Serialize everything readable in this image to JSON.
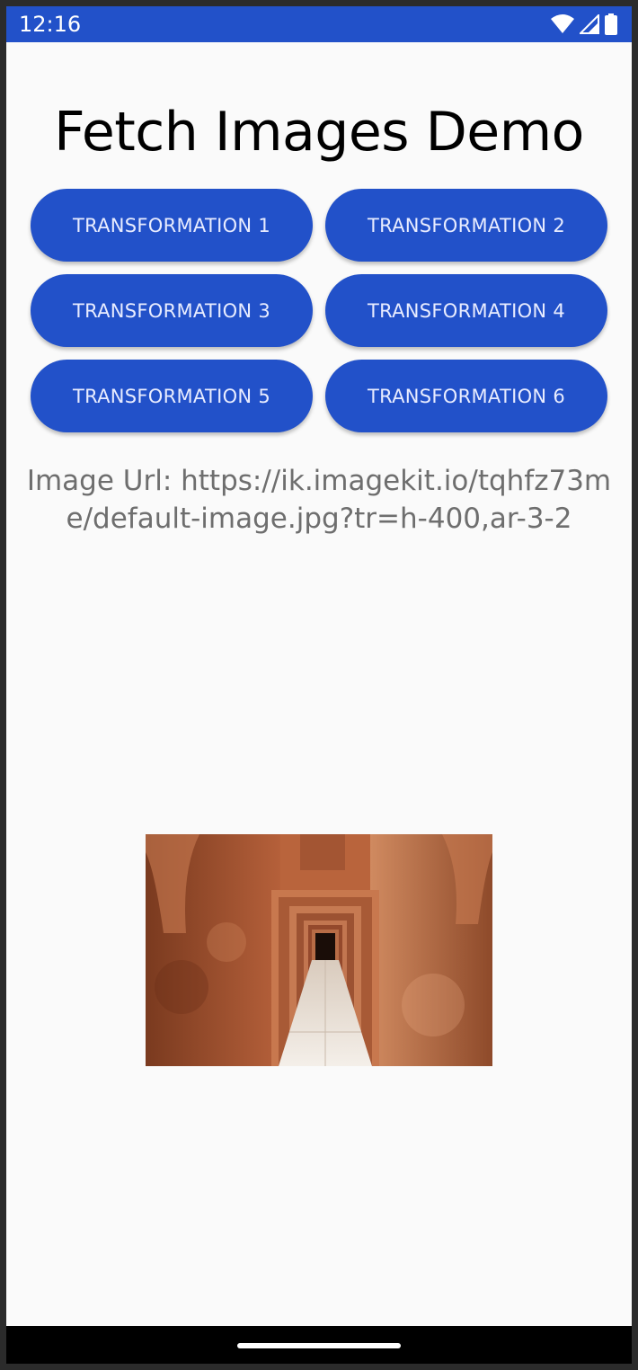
{
  "status_bar": {
    "time": "12:16",
    "icons": [
      "wifi-icon",
      "cellular-signal-icon",
      "battery-icon"
    ],
    "color": "#2251c9"
  },
  "app": {
    "title": "Fetch Images Demo",
    "buttons": [
      "TRANSFORMATION 1",
      "TRANSFORMATION 2",
      "TRANSFORMATION 3",
      "TRANSFORMATION 4",
      "TRANSFORMATION 5",
      "TRANSFORMATION 6"
    ],
    "image_url_text": "Image Url: https://ik.imagekit.io/tqhfz73me/default-image.jpg?tr=h-400,ar-3-2",
    "accent_color": "#2251c9"
  },
  "image": {
    "subject": "corridor-of-arched-doorways-photo"
  }
}
